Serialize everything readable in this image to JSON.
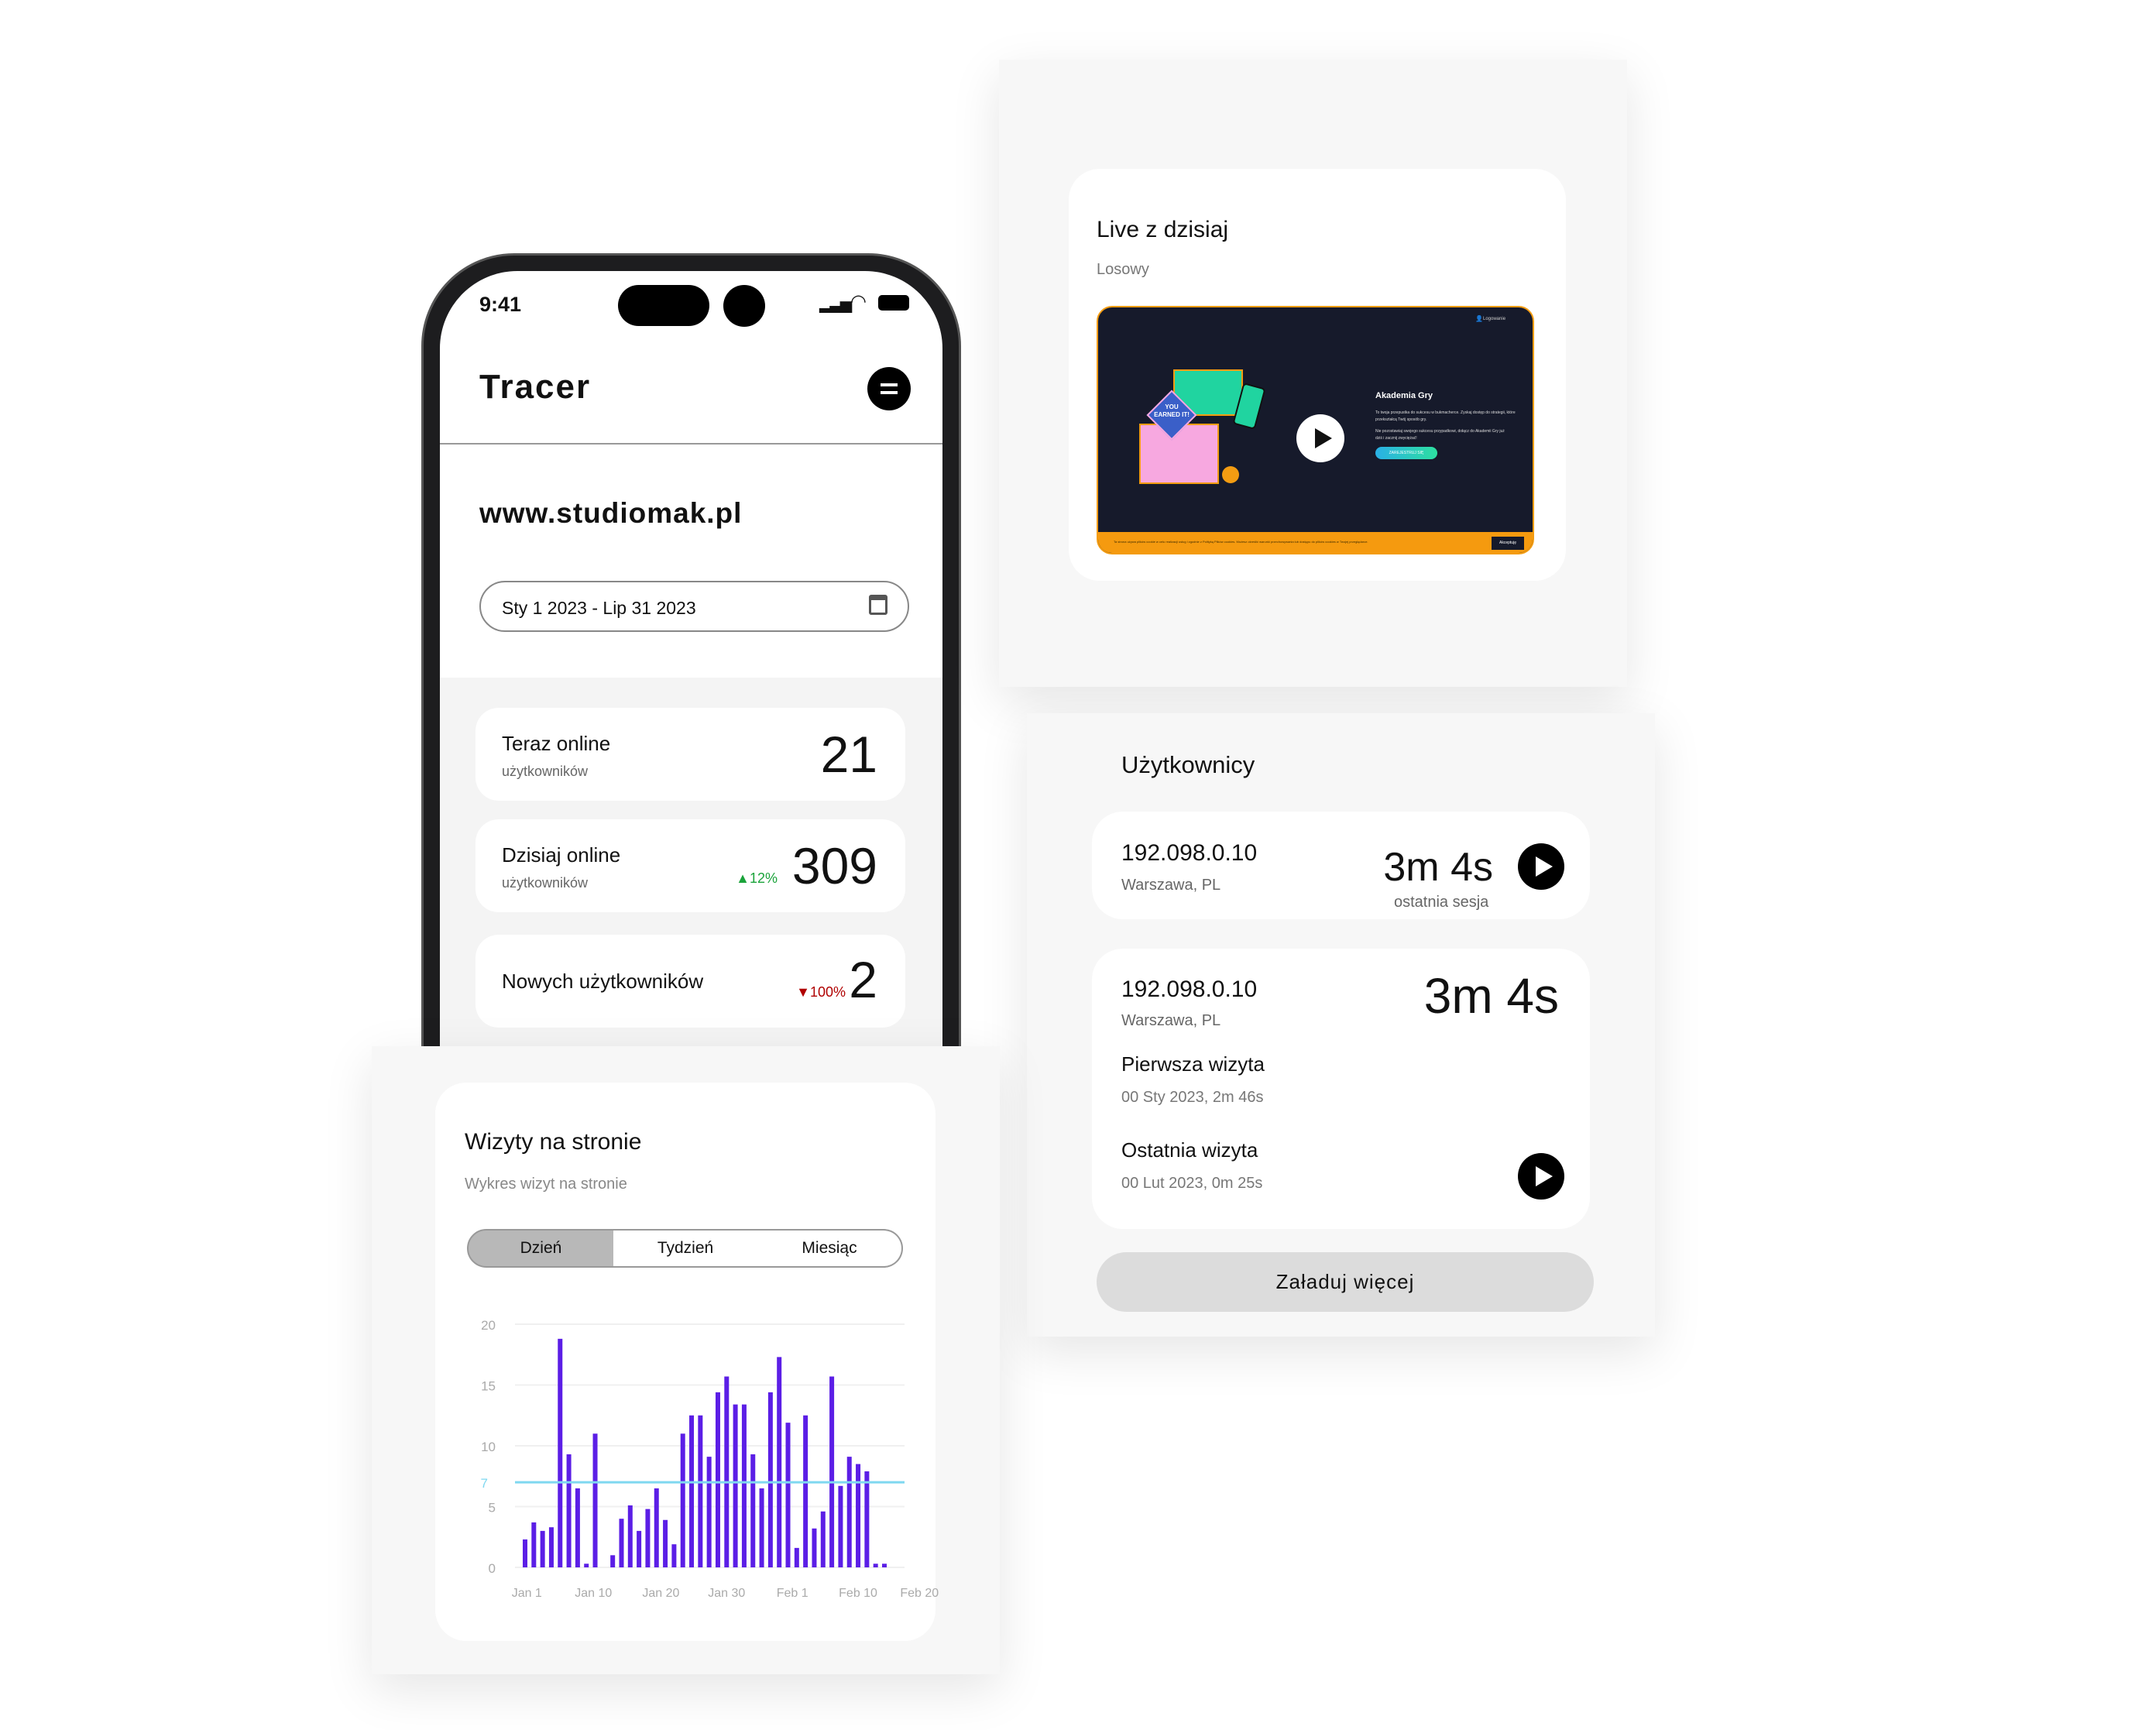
{
  "phone": {
    "status_time": "9:41",
    "app_title": "Tracer",
    "site_url": "www.studiomak.pl",
    "date_range": "Sty 1 2023 - Lip 31 2023",
    "stats": [
      {
        "label": "Teraz online",
        "sub": "użytkowników",
        "value": "21",
        "change": ""
      },
      {
        "label": "Dzisiaj online",
        "sub": "użytkowników",
        "value": "309",
        "change": "▲12%",
        "change_color": "#1aa33a"
      },
      {
        "label": "Nowych użytkowników",
        "sub": "",
        "value": "2",
        "change": "▼100%",
        "change_color": "#b00000"
      }
    ]
  },
  "live": {
    "title": "Live z dzisiaj",
    "subtitle": "Losowy",
    "video": {
      "heading": "Akademia Gry",
      "login": "Logowanie",
      "body1": "To twoja przepustka do sukcesu w bukmacherce. Zyskaj dostęp do strategii, które przekształcą Twój sposób gry.",
      "body2": "Nie pozostawiaj swojego sukcesu przypadkowi, dołącz do Akademii Gry już dziś i zacznij zwyciężać!",
      "cta": "ZAREJESTRUJ SIĘ",
      "cookie_text": "Ta strona używa plików cookie w celu realizacji usług i zgodnie z Polityką Plików cookies. Możesz określić warunki przechowywania lub dostępu do plików cookies w Twojej przeglądarce.",
      "accept": "Akceptuję",
      "earned": "YOU EARNED IT!"
    }
  },
  "users": {
    "title": "Użytkownicy",
    "items": [
      {
        "ip": "192.098.0.10",
        "location": "Warszawa, PL",
        "duration": "3m 4s",
        "duration_label": "ostatnia sesja"
      },
      {
        "ip": "192.098.0.10",
        "location": "Warszawa, PL",
        "duration": "3m 4s",
        "first_visit_label": "Pierwsza wizyta",
        "first_visit": "00 Sty 2023, 2m 46s",
        "last_visit_label": "Ostatnia wizyta",
        "last_visit": "00 Lut 2023, 0m 25s"
      }
    ],
    "load_more": "Załaduj więcej"
  },
  "visits": {
    "title": "Wizyty na stronie",
    "subtitle": "Wykres wizyt na stronie",
    "tabs": [
      "Dzień",
      "Tydzień",
      "Miesiąc"
    ],
    "active_tab": "Dzień"
  },
  "chart_data": {
    "type": "bar",
    "title": "",
    "xlabel": "",
    "ylabel": "",
    "ylim": [
      0,
      20
    ],
    "yticks": [
      0,
      5,
      10,
      15,
      20
    ],
    "xtick_labels": [
      "Jan 1",
      "Jan 10",
      "Jan 20",
      "Jan 30",
      "Feb 1",
      "Feb 10",
      "Feb 20"
    ],
    "values": [
      2.3,
      3.7,
      3,
      3.3,
      18.8,
      9.3,
      6.5,
      0.3,
      11,
      0,
      1,
      4,
      5.1,
      3,
      4.8,
      6.5,
      3.9,
      1.9,
      11,
      12.5,
      12.5,
      9.1,
      14.4,
      15.7,
      13.4,
      13.4,
      9.3,
      6.5,
      14.4,
      17.3,
      11.9,
      1.6,
      12.5,
      3.2,
      4.6,
      15.7,
      6.7,
      9.1,
      8.5,
      7.9,
      0.3,
      0.3
    ],
    "average_line": {
      "value": 7,
      "label": "7",
      "color": "#7fd8f0"
    },
    "bar_color": "#5b1ee6",
    "grid": true
  }
}
